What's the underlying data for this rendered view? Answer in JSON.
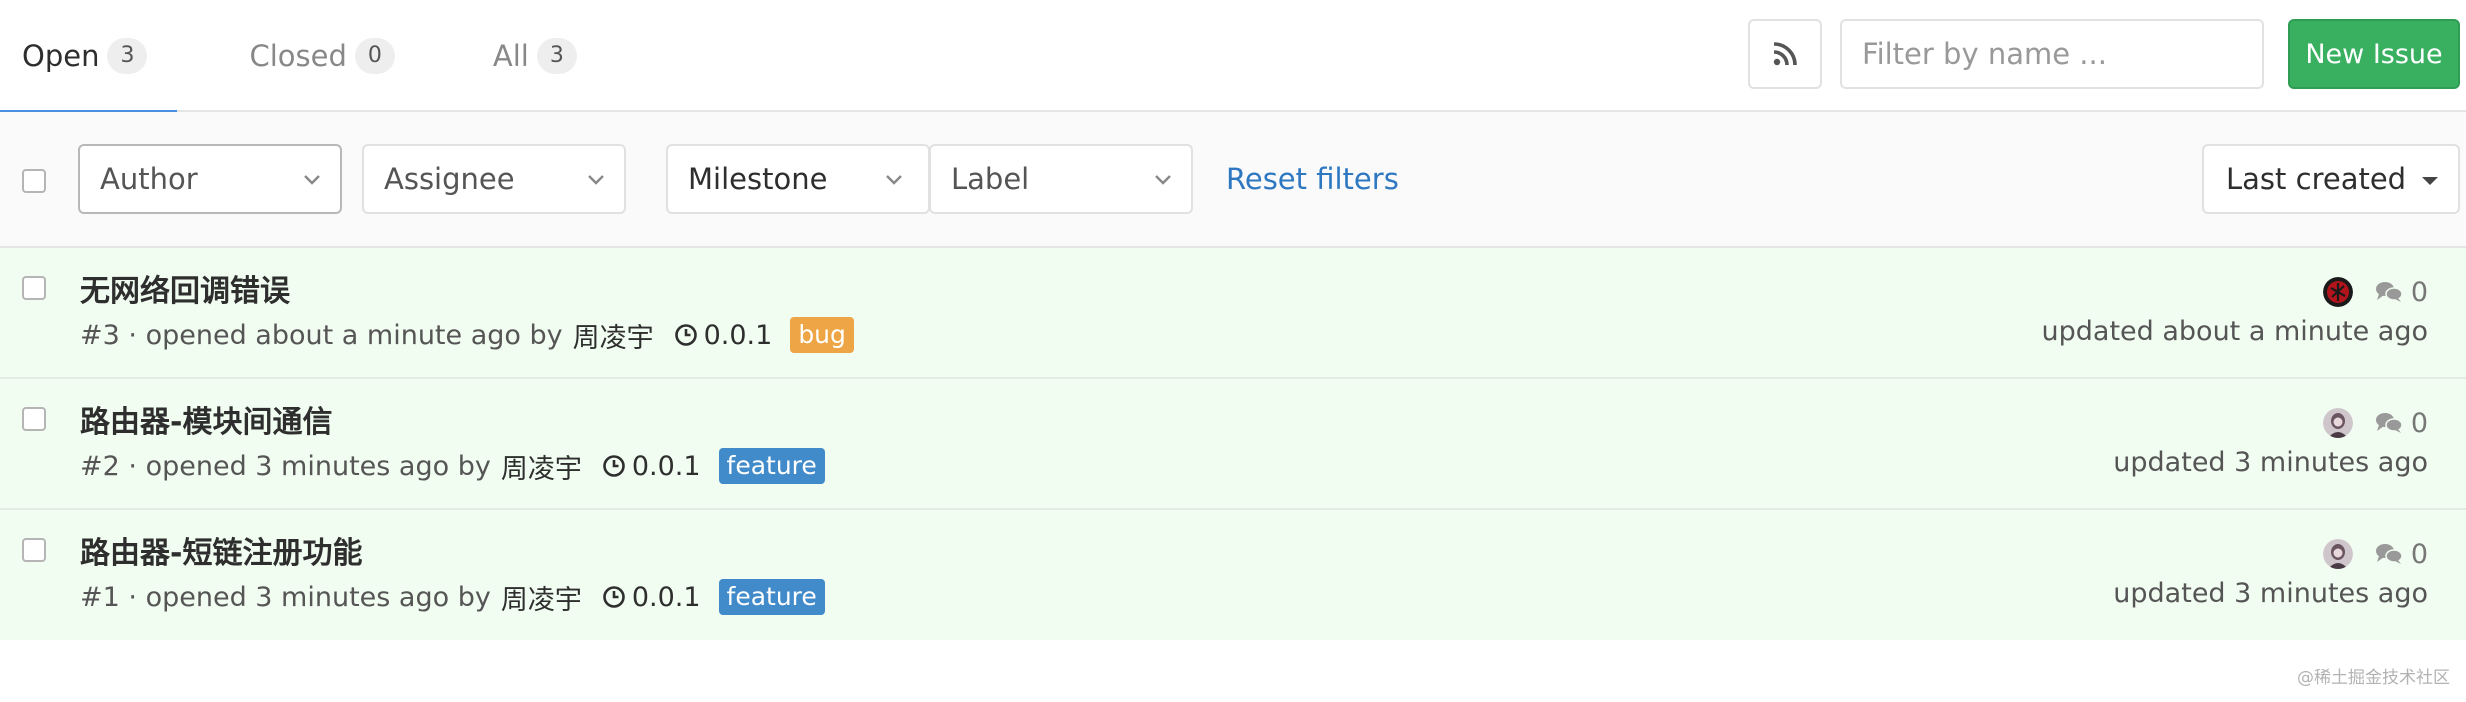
{
  "tabs": [
    {
      "label": "Open",
      "count": "3"
    },
    {
      "label": "Closed",
      "count": "0"
    },
    {
      "label": "All",
      "count": "3"
    }
  ],
  "toolbar": {
    "rss_icon": "rss-icon",
    "filter_placeholder": "Filter by name ...",
    "new_issue_label": "New Issue"
  },
  "filters": {
    "author": "Author",
    "assignee": "Assignee",
    "milestone": "Milestone",
    "label": "Label",
    "reset": "Reset filters",
    "sort": "Last created"
  },
  "issues": [
    {
      "title": "无网络回调错误",
      "number": "#3",
      "opened": "· opened about a minute ago by",
      "author": "周凌宇",
      "milestone": "0.0.1",
      "label": "bug",
      "label_color": "#eea545",
      "comments": "0",
      "updated": "updated about a minute ago"
    },
    {
      "title": "路由器-模块间通信",
      "number": "#2",
      "opened": "· opened 3 minutes ago by",
      "author": "周凌宇",
      "milestone": "0.0.1",
      "label": "feature",
      "label_color": "#428bca",
      "comments": "0",
      "updated": "updated 3 minutes ago"
    },
    {
      "title": "路由器-短链注册功能",
      "number": "#1",
      "opened": "· opened 3 minutes ago by",
      "author": "周凌宇",
      "milestone": "0.0.1",
      "label": "feature",
      "label_color": "#428bca",
      "comments": "0",
      "updated": "updated 3 minutes ago"
    }
  ],
  "watermark": "@稀土掘金技术社区",
  "colors": {
    "accent": "#4a90e2",
    "new_issue_green": "#38b060",
    "link_blue": "#2e78c2",
    "row_background": "#f2fdf2"
  }
}
